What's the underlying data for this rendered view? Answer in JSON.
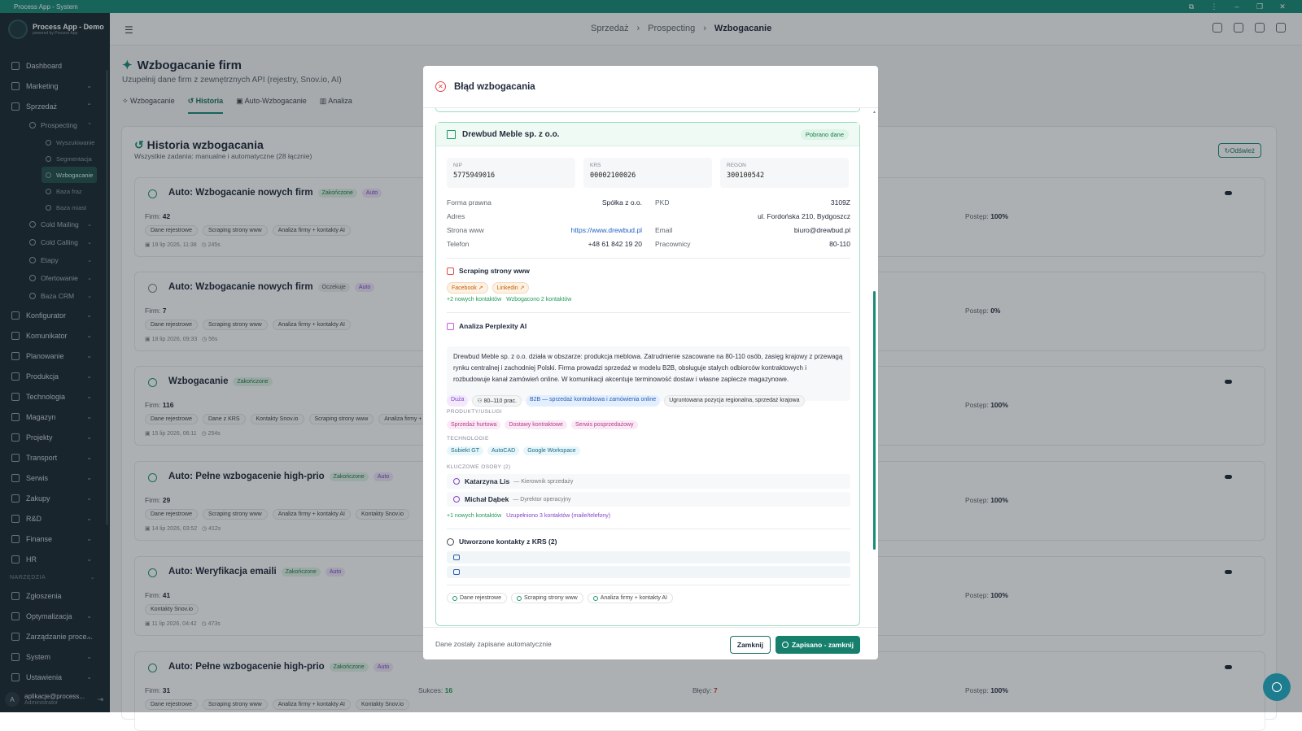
{
  "window": {
    "title": "Process App - System"
  },
  "sidebar": {
    "app_name": "Process App - Demo",
    "app_sub": "powered by Process App",
    "items": [
      {
        "label": "Dashboard"
      },
      {
        "label": "Marketing"
      },
      {
        "label": "Sprzedaż"
      }
    ],
    "prospecting": {
      "label": "Prospecting"
    },
    "prospecting_sub": [
      {
        "label": "Wyszukiwanie"
      },
      {
        "label": "Segmentacja"
      },
      {
        "label": "Wzbogacanie"
      },
      {
        "label": "Baza fraz"
      },
      {
        "label": "Baza miast"
      }
    ],
    "sales_sub": [
      {
        "label": "Cold Mailing"
      },
      {
        "label": "Cold Calling"
      },
      {
        "label": "Etapy"
      },
      {
        "label": "Ofertowanie"
      },
      {
        "label": "Baza CRM"
      }
    ],
    "modules": [
      {
        "label": "Konfigurator"
      },
      {
        "label": "Komunikator"
      },
      {
        "label": "Planowanie"
      },
      {
        "label": "Produkcja"
      },
      {
        "label": "Technologia"
      },
      {
        "label": "Magazyn"
      },
      {
        "label": "Projekty"
      },
      {
        "label": "Transport"
      },
      {
        "label": "Serwis"
      },
      {
        "label": "Zakupy"
      },
      {
        "label": "R&D"
      },
      {
        "label": "Finanse"
      },
      {
        "label": "HR"
      }
    ],
    "tools_section": "NARZĘDZIA",
    "tools": [
      {
        "label": "Zgłoszenia"
      },
      {
        "label": "Optymalizacja"
      },
      {
        "label": "Zarządzanie proce..."
      },
      {
        "label": "System"
      },
      {
        "label": "Ustawienia"
      }
    ],
    "user": {
      "initial": "A",
      "email": "aplikacje@process...",
      "role": "Administrator"
    }
  },
  "breadcrumb": {
    "items": [
      "Sprzedaż",
      "Prospecting"
    ],
    "current": "Wzbogacanie"
  },
  "page": {
    "title": "Wzbogacanie firm",
    "subtitle": "Uzupełnij dane firm z zewnętrznych API (rejestry, Snov.io, AI)",
    "tabs": [
      "Wzbogacanie",
      "Historia",
      "Auto-Wzbogacanie",
      "Analiza"
    ]
  },
  "history": {
    "title": "Historia wzbogacania",
    "subtitle": "Wszystkie zadania: manualne i automatyczne (28 łącznie)",
    "refresh": "Odśwież",
    "firm_label": "Firm:",
    "progress_label": "Postęp:",
    "success_label": "Sukces:",
    "errors_label": "Błędy:",
    "jobs": [
      {
        "title": "Auto: Wzbogacanie nowych firm",
        "status": "Zakończone",
        "auto": "Auto",
        "firms": "42",
        "progress": "100%",
        "chips": [
          "Dane rejestrowe",
          "Scraping strony www",
          "Analiza firmy + kontakty AI"
        ],
        "date": "19 lip 2026, 11:38",
        "dur": "245s"
      },
      {
        "title": "Auto: Wzbogacanie nowych firm",
        "status": "Oczekuje",
        "auto": "Auto",
        "firms": "7",
        "progress": "0%",
        "chips": [
          "Dane rejestrowe",
          "Scraping strony www",
          "Analiza firmy + kontakty AI"
        ],
        "date": "18 lip 2026, 09:33",
        "dur": "56s"
      },
      {
        "title": "Wzbogacanie",
        "status": "Zakończone",
        "auto": "",
        "firms": "116",
        "progress": "100%",
        "chips": [
          "Dane rejestrowe",
          "Dane z KRS",
          "Kontakty Snov.io",
          "Scraping strony www",
          "Analiza firmy +"
        ],
        "date": "15 lip 2026, 06:11",
        "dur": "254s"
      },
      {
        "title": "Auto: Pełne wzbogacenie high-prio",
        "status": "Zakończone",
        "auto": "Auto",
        "firms": "29",
        "progress": "100%",
        "chips": [
          "Dane rejestrowe",
          "Scraping strony www",
          "Analiza firmy + kontakty AI",
          "Kontakty Snov.io"
        ],
        "date": "14 lip 2026, 03:52",
        "dur": "412s"
      },
      {
        "title": "Auto: Weryfikacja emaili",
        "status": "Zakończone",
        "auto": "Auto",
        "firms": "41",
        "progress": "100%",
        "chips": [
          "Kontakty Snov.io"
        ],
        "date": "11 lip 2026, 04:42",
        "dur": "473s"
      },
      {
        "title": "Auto: Pełne wzbogacenie high-prio",
        "status": "Zakończone",
        "auto": "Auto",
        "firms": "31",
        "progress": "100%",
        "success": "16",
        "errors": "7",
        "chips": [
          "Dane rejestrowe",
          "Scraping strony www",
          "Analiza firmy + kontakty AI",
          "Kontakty Snov.io"
        ],
        "date": "",
        "dur": ""
      }
    ]
  },
  "modal": {
    "title": "Błąd wzbogacania",
    "company": "Drewbud Meble sp. z o.o.",
    "company_badge": "Pobrano dane",
    "ids": [
      {
        "label": "NIP",
        "value": "5775949016"
      },
      {
        "label": "KRS",
        "value": "00002100026"
      },
      {
        "label": "REGON",
        "value": "300100542"
      }
    ],
    "fields": {
      "forma_k": "Forma prawna",
      "forma_v": "Spółka z o.o.",
      "pkd_k": "PKD",
      "pkd_v": "3109Z",
      "adres_k": "Adres",
      "adres_v": "ul. Fordońska 210, Bydgoszcz",
      "www_k": "Strona www",
      "www_v": "https://www.drewbud.pl",
      "email_k": "Email",
      "email_v": "biuro@drewbud.pl",
      "tel_k": "Telefon",
      "tel_v": "+48 61 842 19 20",
      "prac_k": "Pracownicy",
      "prac_v": "80-110"
    },
    "scraping": {
      "title": "Scraping strony www",
      "links": [
        "Facebook",
        "Linkedin"
      ],
      "new_contacts": "+2 nowych kontaktów",
      "enriched": "Wzbogacono 2 kontaktów"
    },
    "ai": {
      "title": "Analiza Perplexity AI",
      "text": "Drewbud Meble sp. z o.o. działa w obszarze: produkcja meblowa. Zatrudnienie szacowane na 80-110 osób, zasięg krajowy z przewagą rynku centralnej i zachodniej Polski. Firma prowadzi sprzedaż w modelu B2B, obsługuje stałych odbiorców kontraktowych i rozbudowuje kanał zamówień online. W komunikacji akcentuje terminowość dostaw i własne zaplecze magazynowe.",
      "tags": [
        "Duża",
        "80–110 prac.",
        "B2B — sprzedaż kontraktowa i zamówienia online",
        "Ugruntowana pozycja regionalna, sprzedaż krajowa"
      ],
      "products_label": "PRODUKTY/USŁUGI",
      "products": [
        "Sprzedaż hurtowa",
        "Dostawy kontraktowe",
        "Serwis posprzedażowy"
      ],
      "tech_label": "TECHNOLOGIE",
      "tech": [
        "Subiekt GT",
        "AutoCAD",
        "Google Workspace"
      ],
      "people_label": "KLUCZOWE OSOBY (2)",
      "people": [
        {
          "name": "Katarzyna Lis",
          "role": "— Kierownik sprzedaży"
        },
        {
          "name": "Michał Dąbek",
          "role": "— Dyrektor operacyjny"
        }
      ],
      "new_contacts": "+1 nowych kontaktów",
      "filled": "Uzupełniono 3 kontaktów (maile/telefony)"
    },
    "krs": {
      "title": "Utworzone kontakty z KRS (2)"
    },
    "sources": [
      "Dane rejestrowe",
      "Scraping strony www",
      "Analiza firmy + kontakty AI"
    ],
    "footer_note": "Dane zostały zapisane automatycznie",
    "close": "Zamknij",
    "save": "Zapisano - zamknij"
  }
}
